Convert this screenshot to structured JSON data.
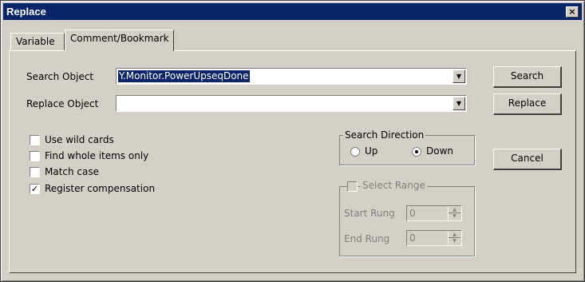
{
  "window": {
    "title": "Replace",
    "close_glyph": "×"
  },
  "tabs": [
    {
      "label": "Variable",
      "active": false
    },
    {
      "label": "Comment/Bookmark",
      "active": true
    }
  ],
  "search": {
    "label": "Search Object",
    "value": "Y.Monitor.PowerUpseqDone"
  },
  "replace": {
    "label": "Replace Object",
    "value": ""
  },
  "buttons": {
    "search": "Search",
    "replace": "Replace",
    "cancel": "Cancel"
  },
  "options": [
    {
      "label": "Use wild cards",
      "checked": false
    },
    {
      "label": "Find whole items only",
      "checked": false
    },
    {
      "label": "Match case",
      "checked": false
    },
    {
      "label": "Register compensation",
      "checked": true
    }
  ],
  "direction": {
    "title": "Search Direction",
    "up": "Up",
    "down": "Down",
    "selected": "Down"
  },
  "range": {
    "title": "Select Range",
    "checked": false,
    "enabled": false,
    "start_label": "Start Rung",
    "start_value": "0",
    "end_label": "End Rung",
    "end_value": "0"
  },
  "colors": {
    "titlebar": "#0a246a",
    "face": "#d4d0c8",
    "selection": "#0a246a"
  }
}
